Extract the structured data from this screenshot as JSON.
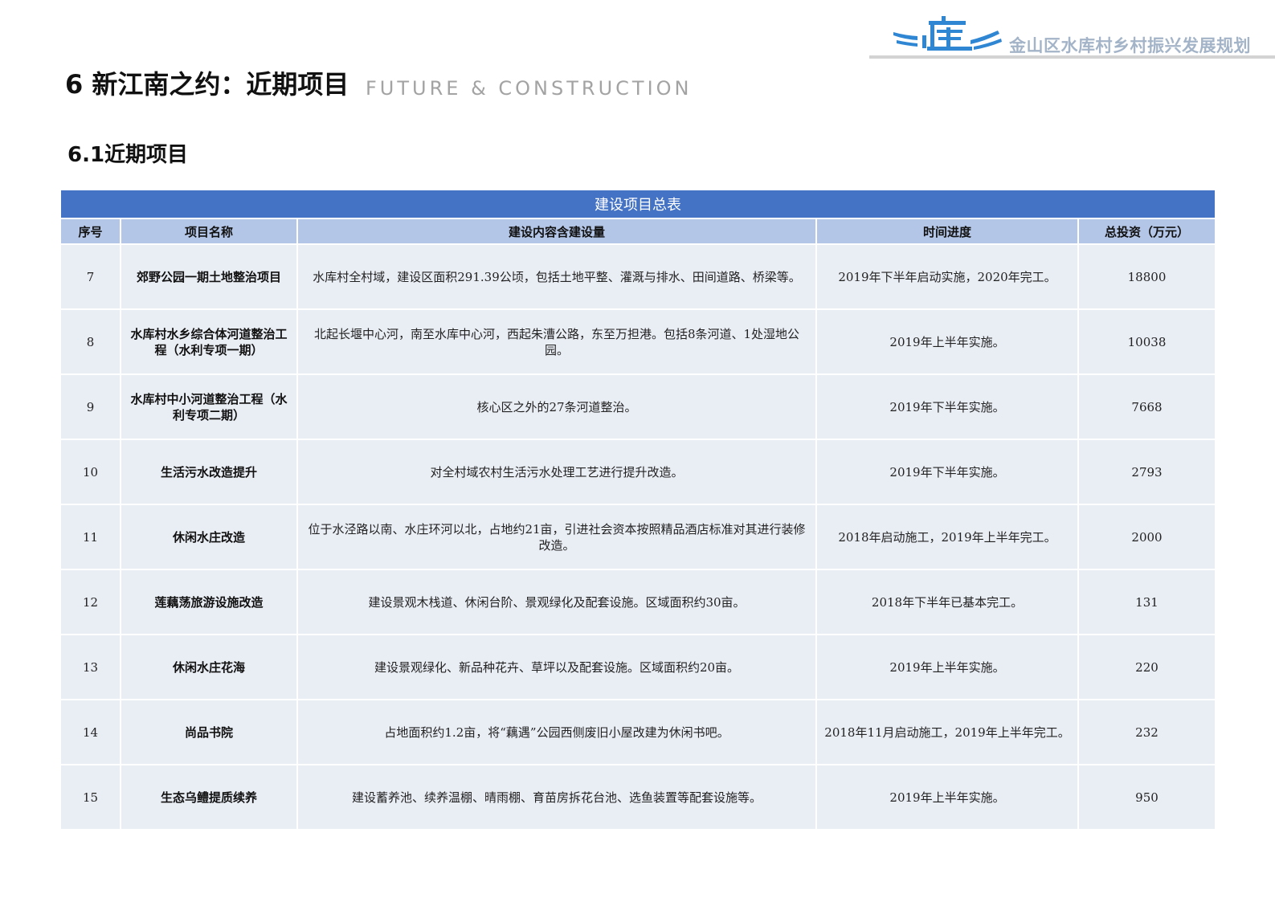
{
  "header": {
    "brand_title": "金山区水库村乡村振兴发展规划",
    "logo_icon": "shuiku-village-logo-icon",
    "logo_color": "#2f86d3"
  },
  "page": {
    "title": "6 新江南之约：近期项目",
    "subtitle": "FUTURE & CONSTRUCTION",
    "section_title": "6.1近期项目"
  },
  "table": {
    "title": "建设项目总表",
    "header_color": "#4472c4",
    "columns": [
      "序号",
      "项目名称",
      "建设内容含建设量",
      "时间进度",
      "总投资（万元）"
    ],
    "rows": [
      {
        "no": "7",
        "name": "郊野公园一期土地整治项目",
        "content": "水库村全村域，建设区面积291.39公顷，包括土地平整、灌溉与排水、田间道路、桥梁等。",
        "schedule": "2019年下半年启动实施，2020年完工。",
        "investment": "18800"
      },
      {
        "no": "8",
        "name": "水库村水乡综合体河道整治工程（水利专项一期）",
        "content": "北起长堰中心河，南至水库中心河，西起朱漕公路，东至万担港。包括8条河道、1处湿地公园。",
        "schedule": "2019年上半年实施。",
        "investment": "10038"
      },
      {
        "no": "9",
        "name": "水库村中小河道整治工程（水利专项二期）",
        "content": "核心区之外的27条河道整治。",
        "schedule": "2019年下半年实施。",
        "investment": "7668"
      },
      {
        "no": "10",
        "name": "生活污水改造提升",
        "content": "对全村域农村生活污水处理工艺进行提升改造。",
        "schedule": "2019年下半年实施。",
        "investment": "2793"
      },
      {
        "no": "11",
        "name": "休闲水庄改造",
        "content": "位于水泾路以南、水庄环河以北，占地约21亩，引进社会资本按照精品酒店标准对其进行装修改造。",
        "schedule": "2018年启动施工，2019年上半年完工。",
        "investment": "2000"
      },
      {
        "no": "12",
        "name": "莲藕荡旅游设施改造",
        "content": "建设景观木栈道、休闲台阶、景观绿化及配套设施。区域面积约30亩。",
        "schedule": "2018年下半年已基本完工。",
        "investment": "131"
      },
      {
        "no": "13",
        "name": "休闲水庄花海",
        "content": "建设景观绿化、新品种花卉、草坪以及配套设施。区域面积约20亩。",
        "schedule": "2019年上半年实施。",
        "investment": "220"
      },
      {
        "no": "14",
        "name": "尚品书院",
        "content": "占地面积约1.2亩，将“藕遇”公园西侧废旧小屋改建为休闲书吧。",
        "schedule": "2018年11月启动施工，2019年上半年完工。",
        "investment": "232"
      },
      {
        "no": "15",
        "name": "生态乌鳢提质续养",
        "content": "建设蓄养池、续养温棚、晴雨棚、育苗房拆花台池、选鱼装置等配套设施等。",
        "schedule": "2019年上半年实施。",
        "investment": "950"
      }
    ]
  }
}
